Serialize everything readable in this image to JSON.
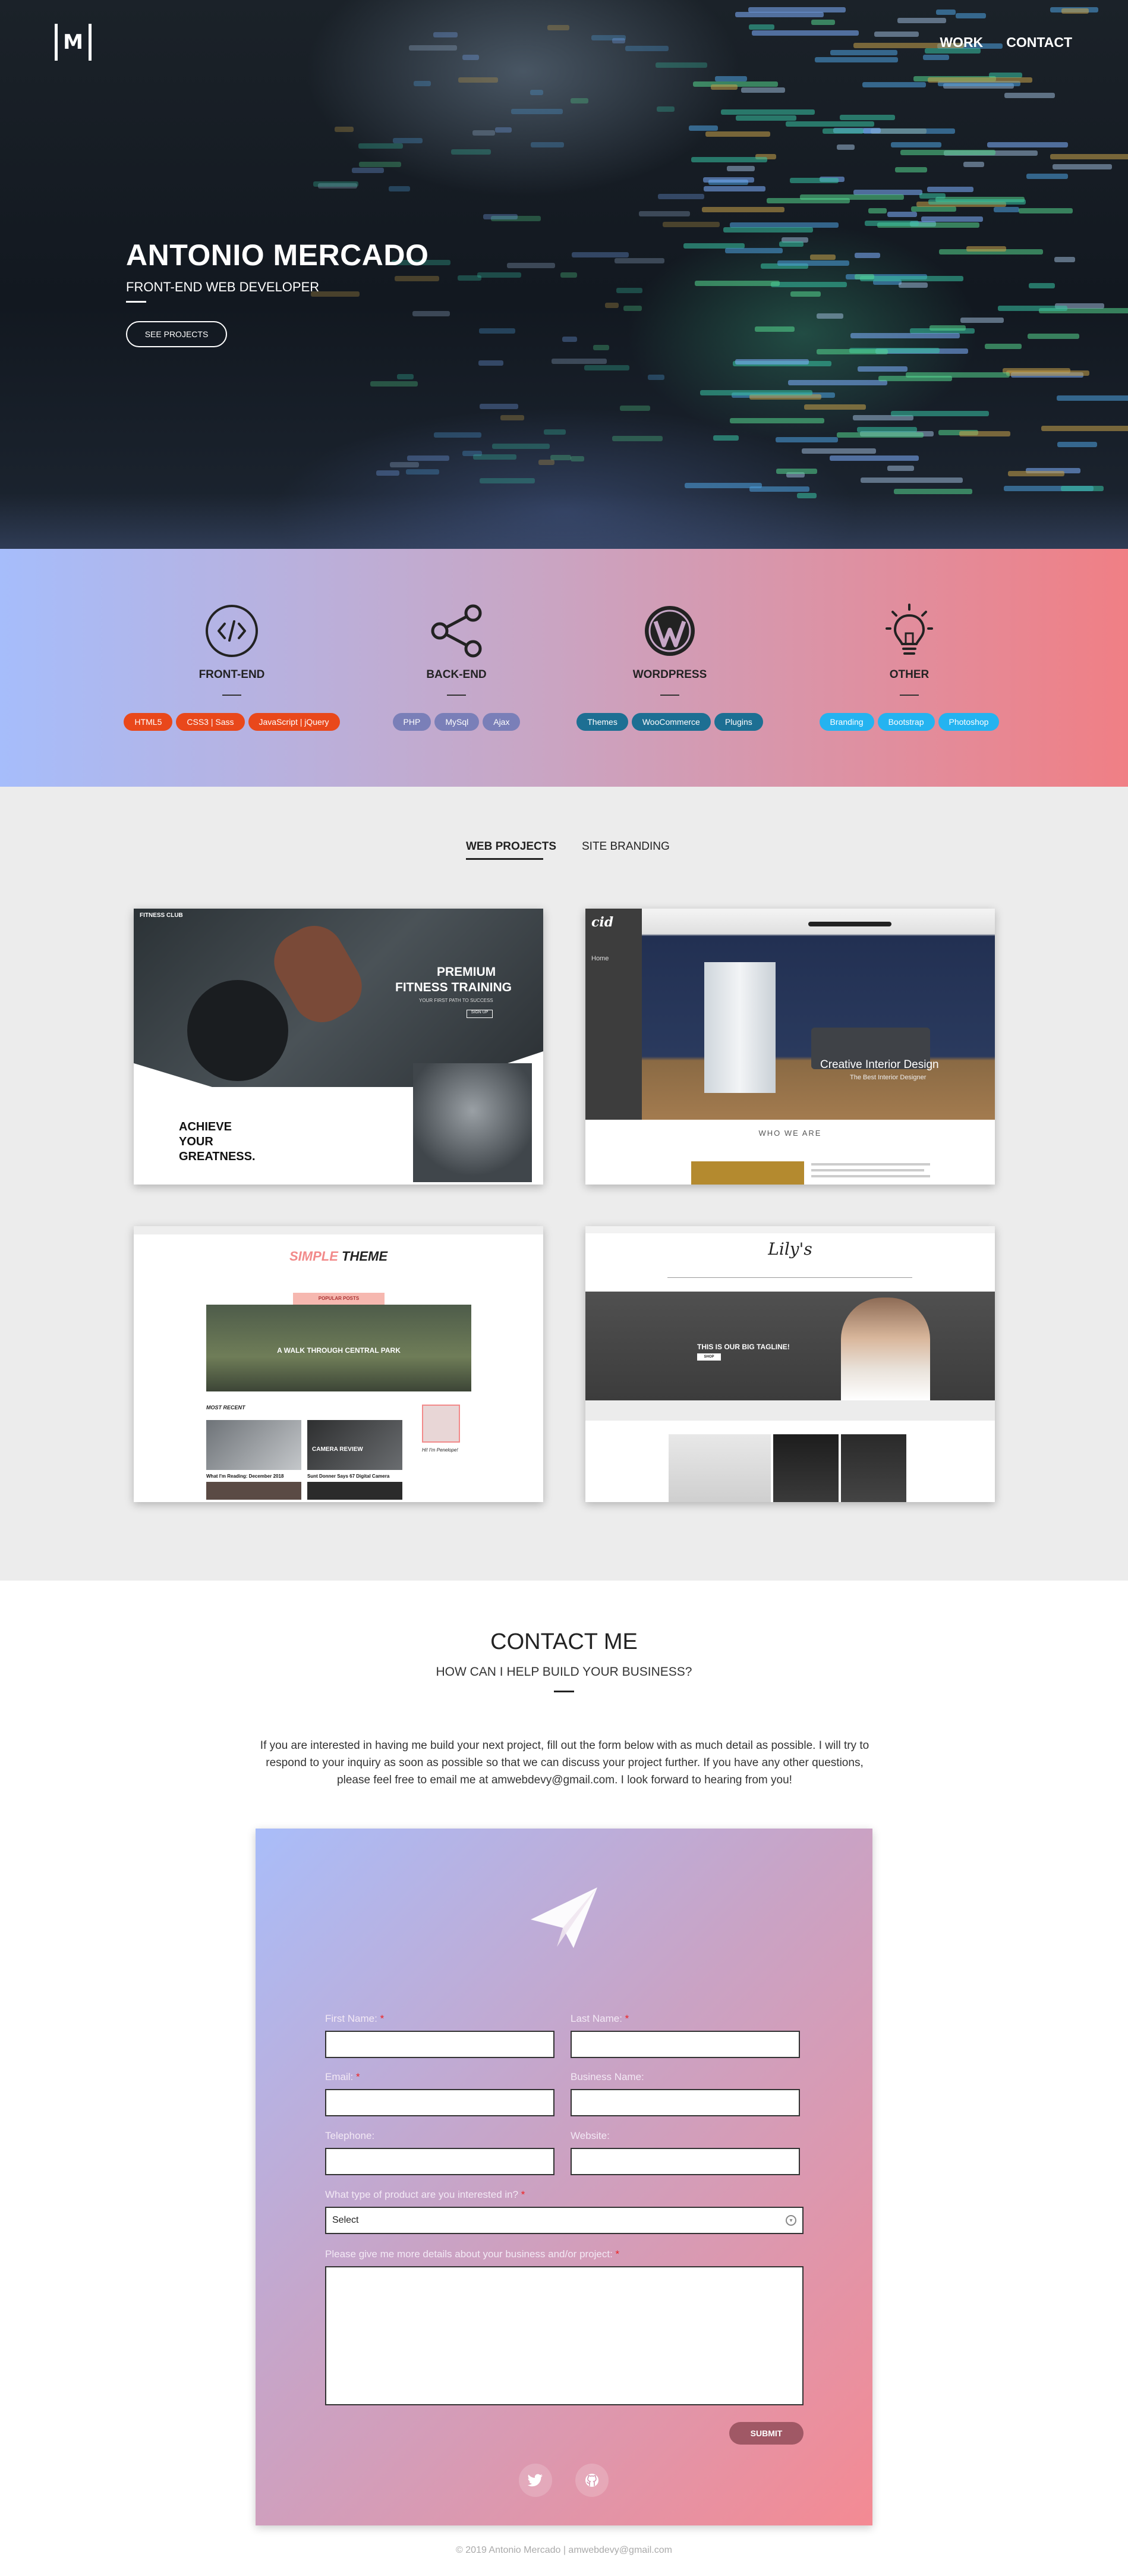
{
  "nav": {
    "logo": "M",
    "items": [
      "WORK",
      "CONTACT"
    ]
  },
  "hero": {
    "name": "ANTONIO MERCADO",
    "role": "FRONT-END WEB DEVELOPER",
    "button": "SEE PROJECTS"
  },
  "skills": [
    {
      "icon": "code-icon",
      "title": "FRONT-END",
      "tags": [
        "HTML5",
        "CSS3 | Sass",
        "JavaScript | jQuery"
      ],
      "tag_color": "#e9481b"
    },
    {
      "icon": "share-icon",
      "title": "BACK-END",
      "tags": [
        "PHP",
        "MySql",
        "Ajax"
      ],
      "tag_color": "#7a7fb8"
    },
    {
      "icon": "wordpress-icon",
      "title": "WORDPRESS",
      "tags": [
        "Themes",
        "WooCommerce",
        "Plugins"
      ],
      "tag_color": "#1d6f93"
    },
    {
      "icon": "lightbulb-icon",
      "title": "OTHER",
      "tags": [
        "Branding",
        "Bootstrap",
        "Photoshop"
      ],
      "tag_color": "#24b3f0"
    }
  ],
  "work": {
    "tabs": [
      "WEB PROJECTS",
      "SITE BRANDING"
    ],
    "projects": [
      {
        "name": "fitness-club",
        "brand": "FITNESS CLUB",
        "headline1": "PREMIUM",
        "headline2": "FITNESS TRAINING",
        "sub": "YOUR FIRST PATH TO SUCCESS",
        "btn": "SIGN UP",
        "tagline": [
          "ACHIEVE",
          "YOUR",
          "GREATNESS."
        ]
      },
      {
        "name": "creative-interior-design",
        "brand": "cid",
        "menu": "Home",
        "caption": "Creative Interior Design",
        "caption_sub": "The Best Interior Designer",
        "section": "WHO WE ARE"
      },
      {
        "name": "simple-theme",
        "title_a": "SIMPLE",
        "title_b": "THEME",
        "popular": "POPULAR POSTS",
        "feature": "A WALK THROUGH CENTRAL PARK",
        "recent": "MOST RECENT",
        "post1": "What I'm Reading: December 2018",
        "post2": "Sunt Donner Says 67 Digital Camera",
        "card": "CAMERA REVIEW",
        "side": "Hi! I'm Penelope!"
      },
      {
        "name": "lilys",
        "brand": "Lily's",
        "hero": "THIS IS OUR BIG TAGLINE!",
        "btn": "SHOP"
      }
    ]
  },
  "contact": {
    "title": "CONTACT ME",
    "subtitle": "HOW CAN I HELP BUILD YOUR BUSINESS?",
    "intro": "If you are interested in having me build your next project, fill out the form below with as much detail as possible. I will try to respond to your inquiry as soon as possible so that we can discuss your project further. If you have any other questions, please feel free to email me at amwebdevy@gmail.com. I look forward to hearing from you!",
    "form": {
      "first_name": "First Name:",
      "last_name": "Last Name:",
      "email": "Email:",
      "business_name": "Business Name:",
      "telephone": "Telephone:",
      "website": "Website:",
      "product": "What type of product are you interested in?",
      "select_value": "Select",
      "details": "Please give me more details about your business and/or project:",
      "submit": "SUBMIT"
    }
  },
  "footer": "© 2019 Antonio Mercado | amwebdevy@gmail.com"
}
